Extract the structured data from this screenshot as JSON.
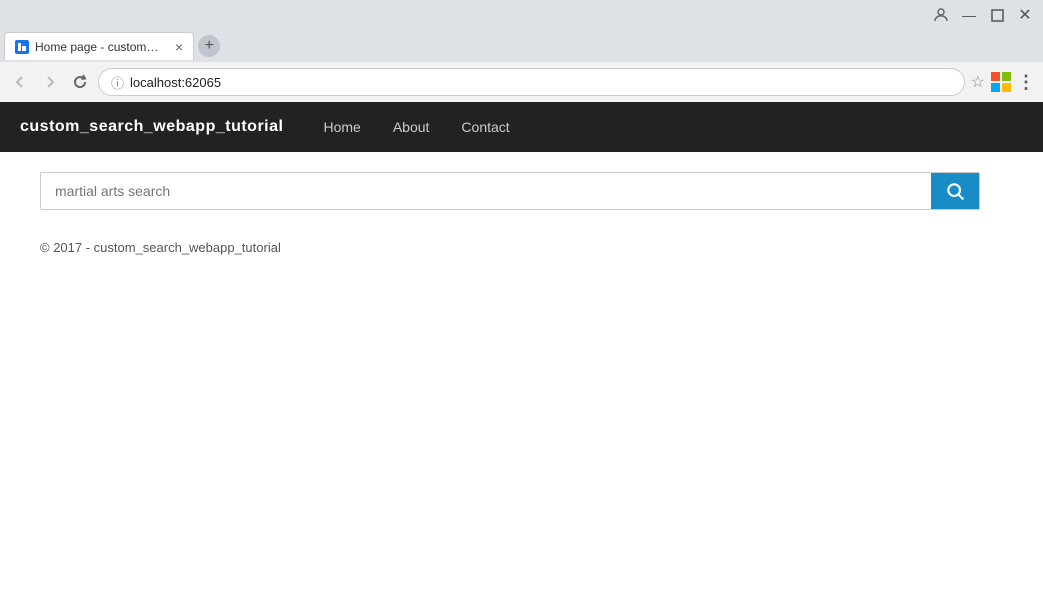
{
  "browser": {
    "tab_title": "Home page - custom_se",
    "tab_close": "×",
    "address": "localhost:62065",
    "user_icon": "👤",
    "minimize": "—",
    "restore": "□",
    "close": "✕"
  },
  "navbar": {
    "brand": "custom_search_webapp_tutorial",
    "links": [
      {
        "label": "Home",
        "id": "home"
      },
      {
        "label": "About",
        "id": "about"
      },
      {
        "label": "Contact",
        "id": "contact"
      }
    ]
  },
  "search": {
    "placeholder": "martial arts search",
    "button_label": "🔍"
  },
  "footer": {
    "text": "© 2017 - custom_search_webapp_tutorial"
  }
}
